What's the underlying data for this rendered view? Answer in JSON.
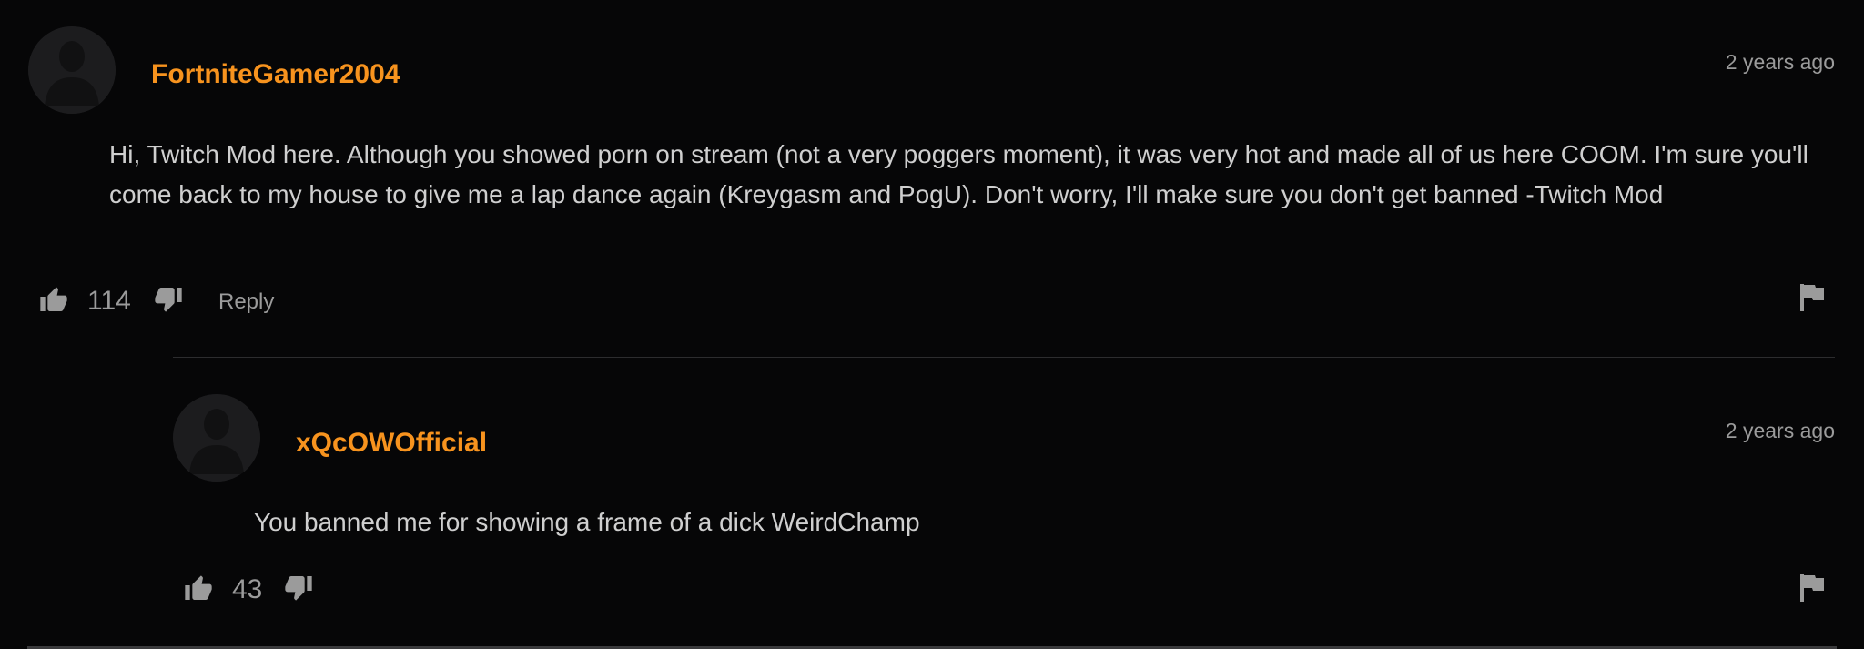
{
  "comments": [
    {
      "username": "FortniteGamer2004",
      "timestamp": "2 years ago",
      "text": "Hi, Twitch Mod here. Although you showed porn on stream (not a very poggers moment), it was very hot and made all of us here COOM. I'm sure you'll come back to my house to give me a lap dance again (Kreygasm and PogU). Don't worry, I'll make sure you don't get banned -Twitch Mod",
      "likes": "114",
      "reply_label": "Reply",
      "icons": {
        "avatar": "user-silhouette-icon",
        "like": "thumbs-up-icon",
        "dislike": "thumbs-down-icon",
        "report": "flag-icon"
      }
    },
    {
      "username": "xQcOWOfficial",
      "timestamp": "2 years ago",
      "text": "You banned me for showing a frame of a dick WeirdChamp",
      "likes": "43",
      "icons": {
        "avatar": "user-silhouette-icon",
        "like": "thumbs-up-icon",
        "dislike": "thumbs-down-icon",
        "report": "flag-icon"
      }
    }
  ],
  "colors": {
    "background": "#060607",
    "username": "#f7931e",
    "body_text": "#cfcfcf",
    "muted_text": "#9b9b9b",
    "avatar_bg": "#1c1c1e",
    "divider": "#2c2c2e"
  }
}
